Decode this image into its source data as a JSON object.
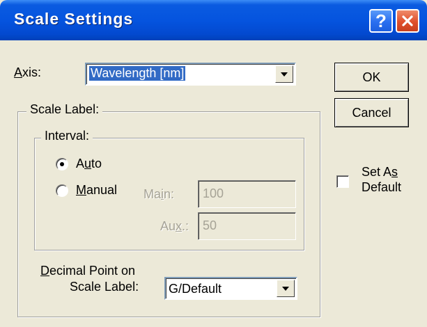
{
  "window": {
    "title": "Scale Settings",
    "help_icon": "question-mark-icon",
    "close_icon": "close-x-icon"
  },
  "axis": {
    "label_pre": "",
    "label_accel": "A",
    "label_post": "xis:",
    "value": "Wavelength [nm]"
  },
  "scale_label_group": {
    "legend": "Scale Label:"
  },
  "interval_group": {
    "legend": "Interval:",
    "auto": {
      "label_pre": "A",
      "label_accel": "u",
      "label_post": "to",
      "checked": true
    },
    "manual": {
      "label_pre": "",
      "label_accel": "M",
      "label_post": "anual",
      "checked": false
    },
    "main": {
      "label_pre": "Ma",
      "label_accel": "i",
      "label_post": "n:",
      "value": "100"
    },
    "aux": {
      "label_pre": "Au",
      "label_accel": "x",
      "label_post": ".:",
      "value": "50"
    }
  },
  "decimal": {
    "line1_pre": "",
    "line1_accel": "D",
    "line1_post": "ecimal Point on",
    "line2": "Scale Label:",
    "value": "G/Default"
  },
  "buttons": {
    "ok": "OK",
    "cancel": "Cancel"
  },
  "set_as_default": {
    "line1_pre": "Set A",
    "line1_accel": "s",
    "line1_post": "",
    "line2": "Default",
    "checked": false
  },
  "colors": {
    "titlebar": "#0554df",
    "dialog_bg": "#ece9d8",
    "selection": "#316ac5"
  }
}
